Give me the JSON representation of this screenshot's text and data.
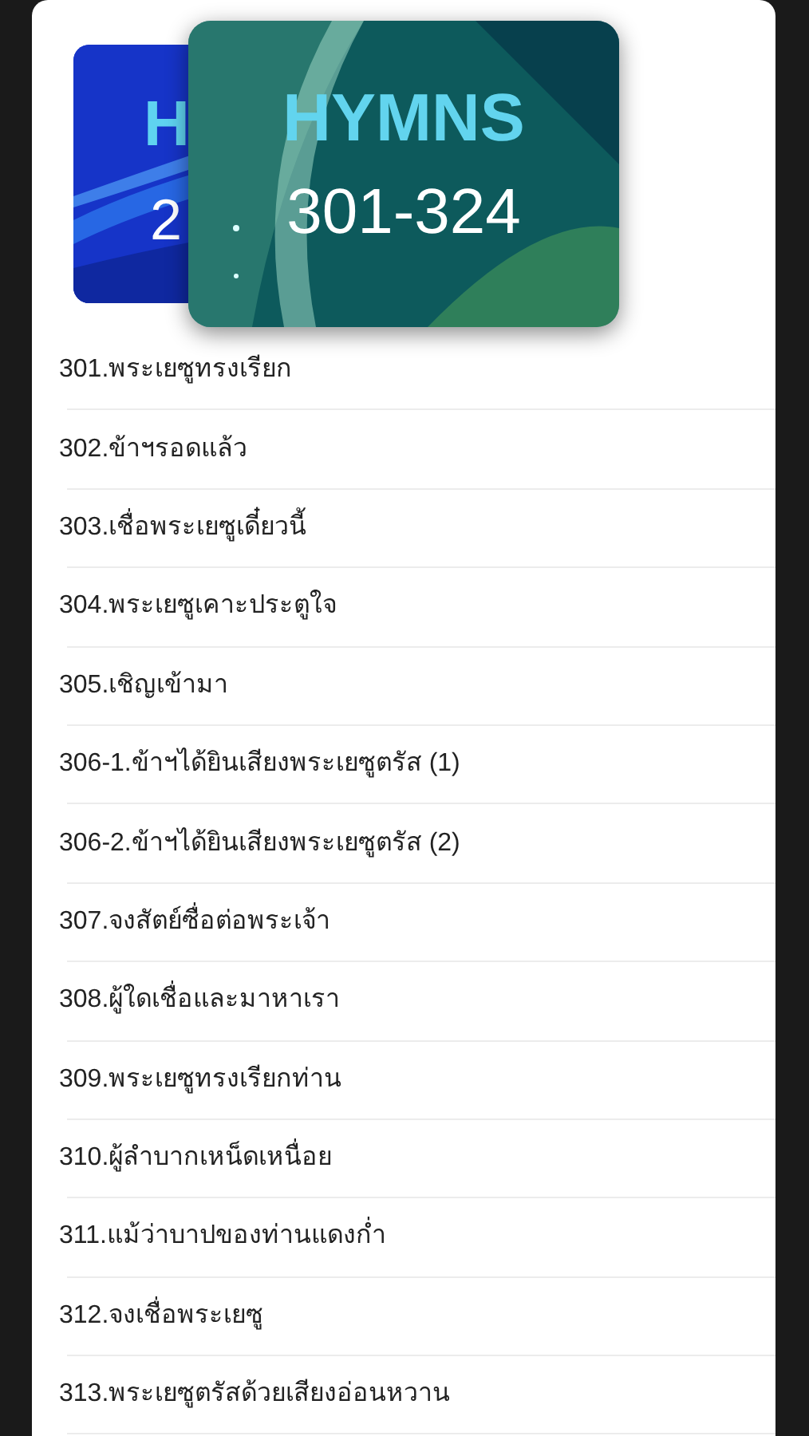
{
  "header": {
    "back_card": {
      "title": "H",
      "range": "2"
    },
    "front_card": {
      "title": "HYMNS",
      "range": "301-324"
    }
  },
  "hymns": [
    {
      "title": "301.พระเยซูทรงเรียก"
    },
    {
      "title": "302.ข้าฯรอดแล้ว"
    },
    {
      "title": "303.เชื่อพระเยซูเดี๋ยวนี้"
    },
    {
      "title": "304.พระเยซูเคาะประตูใจ"
    },
    {
      "title": "305.เชิญเข้ามา"
    },
    {
      "title": "306-1.ข้าฯได้ยินเสียงพระเยซูตรัส (1)"
    },
    {
      "title": "306-2.ข้าฯได้ยินเสียงพระเยซูตรัส (2)"
    },
    {
      "title": "307.จงสัตย์ซื่อต่อพระเจ้า"
    },
    {
      "title": "308.ผู้ใดเชื่อและมาหาเรา"
    },
    {
      "title": "309.พระเยซูทรงเรียกท่าน"
    },
    {
      "title": "310.ผู้ลำบากเหน็ดเหนื่อย"
    },
    {
      "title": "311.แม้ว่าบาปของท่านแดงก่ำ"
    },
    {
      "title": "312.จงเชื่อพระเยซู"
    },
    {
      "title": "313.พระเยซูตรัสด้วยเสียงอ่อนหวาน"
    }
  ]
}
